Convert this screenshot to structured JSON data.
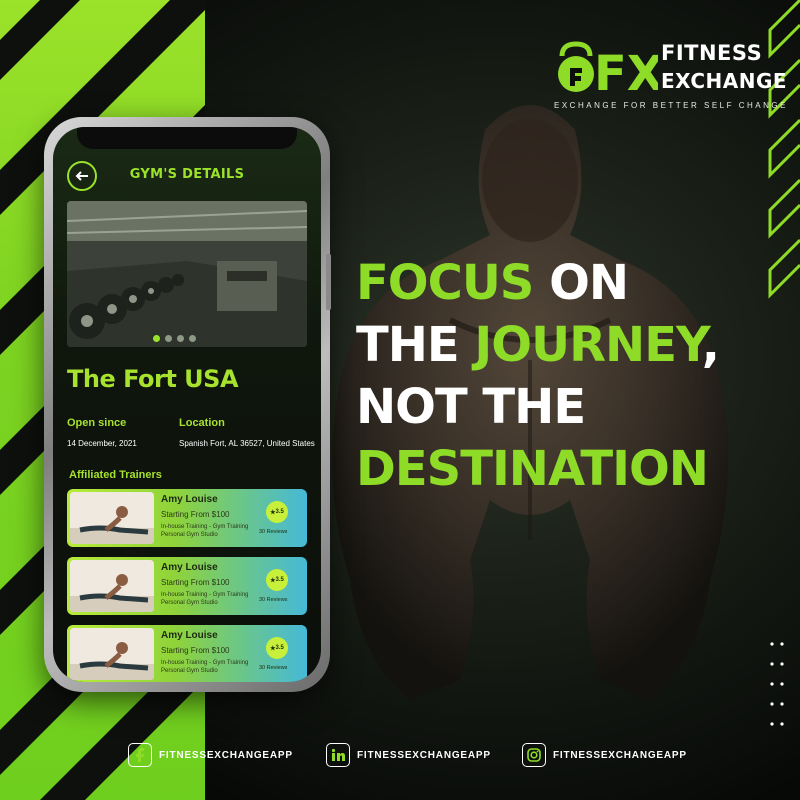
{
  "brand": {
    "logo_letters": "FX",
    "name_line1": "FITNESS",
    "name_line2": "EXCHANGE",
    "tagline": "EXCHANGE FOR BETTER SELF CHANGE"
  },
  "headline": {
    "line1_green": "FOCUS",
    "line1_white": " ON",
    "line2_white": "THE ",
    "line2_green": "JOURNEY",
    "line2_punct": ",",
    "line3": "NOT THE",
    "line4": "DESTINATION"
  },
  "app": {
    "screen_title": "GYM'S DETAILS",
    "gym_name": "The Fort USA",
    "open_since_label": "Open since",
    "open_since_value": "14 December, 2021",
    "location_label": "Location",
    "location_value": "Spanish Fort, AL 36527, United States",
    "trainers_heading": "Affiliated Trainers",
    "trainers": [
      {
        "name": "Amy Louise",
        "price": "Starting From $100",
        "desc_line1": "In-house Training - Gym Training",
        "desc_line2": "Personal Gym Studio",
        "rating": "3.5",
        "reviews": "30 Reviews"
      },
      {
        "name": "Amy Louise",
        "price": "Starting From $100",
        "desc_line1": "In-house Training - Gym Training",
        "desc_line2": "Personal Gym Studio",
        "rating": "3.5",
        "reviews": "30 Reviews"
      },
      {
        "name": "Amy Louise",
        "price": "Starting From $100",
        "desc_line1": "In-house Training - Gym Training",
        "desc_line2": "Personal Gym Studio",
        "rating": "3.5",
        "reviews": "30 Reviews"
      }
    ],
    "carousel_active_index": 0,
    "carousel_count": 4
  },
  "social": {
    "facebook": "FITNESSEXCHANGEAPP",
    "linkedin": "FITNESSEXCHANGEAPP",
    "instagram": "FITNESSEXCHANGEAPP"
  },
  "colors": {
    "accent_green": "#8fdc28",
    "dark_bg": "#0b0f0a",
    "card_blue": "#46b9d8"
  },
  "icons": [
    "back-arrow-icon",
    "star-icon",
    "facebook-icon",
    "linkedin-icon",
    "instagram-icon",
    "kettlebell-icon"
  ]
}
